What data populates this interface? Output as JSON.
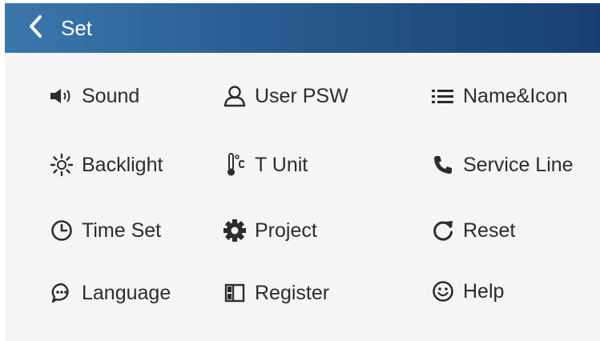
{
  "header": {
    "title": "Set",
    "back_icon": "chevron-left-icon",
    "background_color": "#2a5e92"
  },
  "menu": {
    "items": [
      {
        "label": "Sound",
        "icon": "speaker-icon"
      },
      {
        "label": "User PSW",
        "icon": "user-icon"
      },
      {
        "label": "Name&Icon",
        "icon": "list-icon"
      },
      {
        "label": "Backlight",
        "icon": "sun-icon"
      },
      {
        "label": "T Unit",
        "icon": "thermometer-icon"
      },
      {
        "label": "Service Line",
        "icon": "phone-icon"
      },
      {
        "label": "Time Set",
        "icon": "clock-icon"
      },
      {
        "label": "Project",
        "icon": "gear-icon"
      },
      {
        "label": "Reset",
        "icon": "refresh-icon"
      },
      {
        "label": "Language",
        "icon": "chat-icon"
      },
      {
        "label": "Register",
        "icon": "register-icon"
      },
      {
        "label": "Help",
        "icon": "smiley-icon"
      }
    ]
  }
}
